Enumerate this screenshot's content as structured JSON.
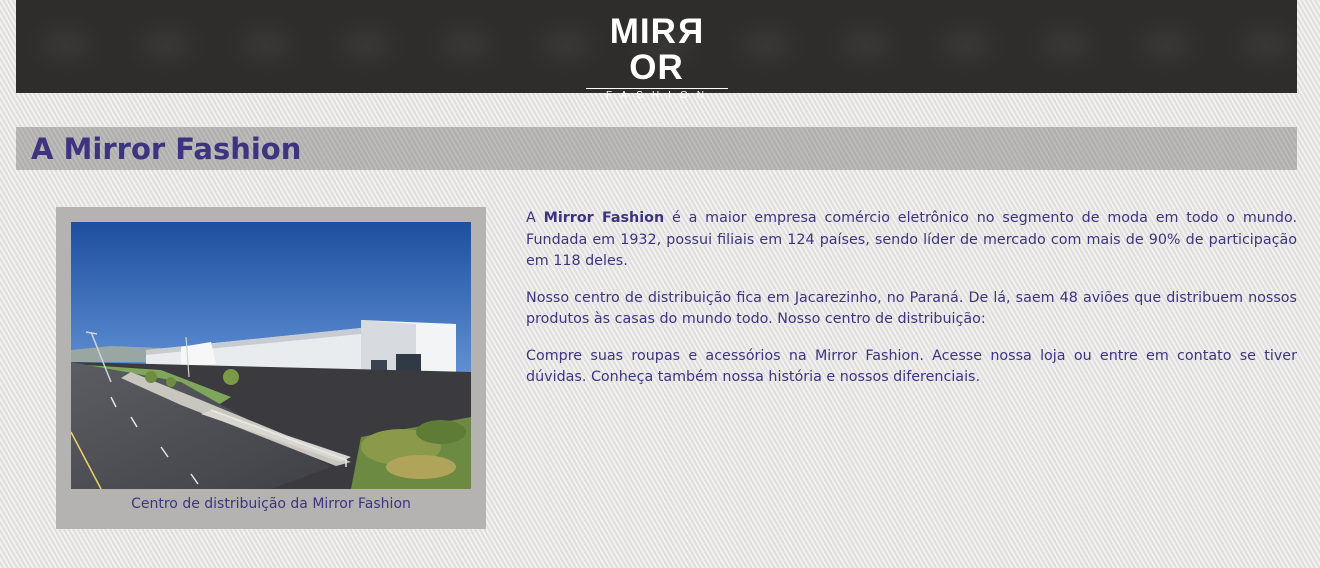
{
  "header": {
    "logo_main_left": "MIR",
    "logo_main_reversed": "R",
    "logo_main_right": "OR",
    "logo_sub": "FASHION"
  },
  "page": {
    "title": "A Mirror Fashion"
  },
  "figure": {
    "caption": "Centro de distribuição da Mirror Fashion"
  },
  "content": {
    "p1_prefix": "A ",
    "p1_brand": "Mirror Fashion",
    "p1_rest": " é a maior empresa comércio eletrônico no segmento de moda em todo o mundo. Fundada em 1932, possui filiais em 124 países, sendo líder de mercado com mais de 90% de participação em 118 deles.",
    "p2": "Nosso centro de distribuição fica em Jacarezinho, no Paraná. De lá, saem 48 aviões que distribuem nossos produtos às casas do mundo todo. Nosso centro de distribuição:",
    "p3": "Compre suas roupas e acessórios na Mirror Fashion. Acesse nossa loja ou entre em contato se tiver dúvidas. Conheça também nossa história e nossos diferenciais."
  },
  "colors": {
    "accent": "#3d3480",
    "header_bg": "#2f2d2b",
    "title_bar_bg": "#b6b5b3",
    "figure_bg": "#b4b3b1"
  }
}
